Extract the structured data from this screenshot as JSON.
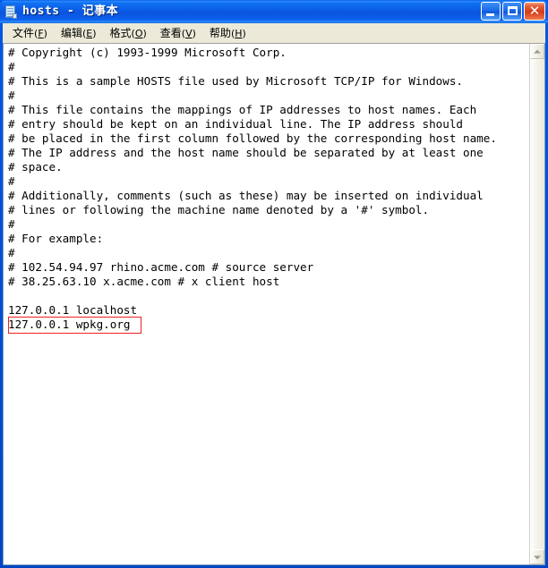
{
  "window": {
    "title": "hosts - 记事本",
    "icon": "notepad-document-icon",
    "accent_title_color": "#0a55e0",
    "menubar_color": "#ece9d8",
    "buttons": {
      "minimize": "_",
      "maximize": "□",
      "close": "✕"
    }
  },
  "menubar": {
    "items": [
      {
        "name": "文件",
        "key": "F"
      },
      {
        "name": "编辑",
        "key": "E"
      },
      {
        "name": "格式",
        "key": "O"
      },
      {
        "name": "查看",
        "key": "V"
      },
      {
        "name": "帮助",
        "key": "H"
      }
    ]
  },
  "document": {
    "lines": [
      "# Copyright (c) 1993-1999 Microsoft Corp.",
      "#",
      "# This is a sample HOSTS file used by Microsoft TCP/IP for Windows.",
      "#",
      "# This file contains the mappings of IP addresses to host names. Each",
      "# entry should be kept on an individual line. The IP address should",
      "# be placed in the first column followed by the corresponding host name.",
      "# The IP address and the host name should be separated by at least one",
      "# space.",
      "#",
      "# Additionally, comments (such as these) may be inserted on individual",
      "# lines or following the machine name denoted by a '#' symbol.",
      "#",
      "# For example:",
      "#",
      "# 102.54.94.97 rhino.acme.com # source server",
      "# 38.25.63.10 x.acme.com # x client host",
      "",
      "127.0.0.1 localhost",
      "127.0.0.1 wpkg.org"
    ],
    "highlight": {
      "line_index": 19,
      "text": "127.0.0.1 wpkg.org",
      "color": "#ee2222"
    }
  },
  "scrollbar": {
    "up_arrow": "▲",
    "down_arrow": "▼"
  }
}
